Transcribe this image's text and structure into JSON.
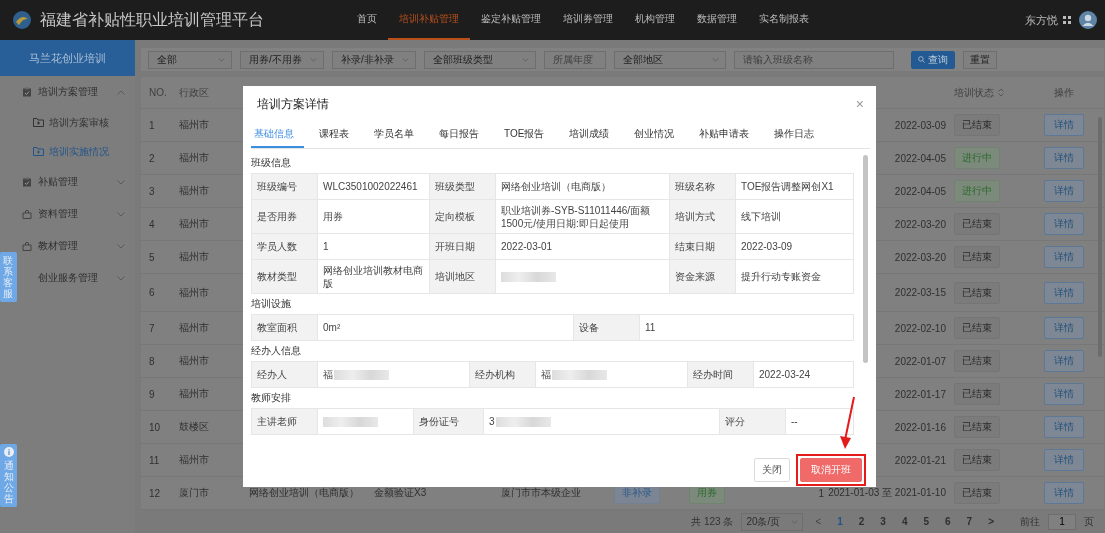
{
  "header": {
    "title": "福建省补贴性职业培训管理平台",
    "user": "东方悦",
    "nav": [
      {
        "label": "首页",
        "selected": false
      },
      {
        "label": "培训补贴管理",
        "selected": true
      },
      {
        "label": "鉴定补贴管理",
        "selected": false
      },
      {
        "label": "培训券管理",
        "selected": false
      },
      {
        "label": "机构管理",
        "selected": false
      },
      {
        "label": "数据管理",
        "selected": false
      },
      {
        "label": "实名制报表",
        "selected": false
      }
    ]
  },
  "sidebar": {
    "title": "马兰花创业培训",
    "menu": [
      {
        "label": "培训方案管理",
        "expanded": true,
        "children": [
          {
            "label": "培训方案审核",
            "selected": false
          },
          {
            "label": "培训实施情况",
            "selected": true
          }
        ]
      },
      {
        "label": "补贴管理",
        "expanded": false
      },
      {
        "label": "资料管理",
        "expanded": false
      },
      {
        "label": "教材管理",
        "expanded": false
      },
      {
        "label": "创业服务管理",
        "expanded": false
      }
    ]
  },
  "float_tabs": [
    "联系客服",
    "通知公告"
  ],
  "filters": [
    {
      "kind": "select",
      "value": "全部"
    },
    {
      "kind": "select",
      "value": "用券/不用券"
    },
    {
      "kind": "select",
      "value": "补录/非补录"
    },
    {
      "kind": "select",
      "value": "全部班级类型"
    },
    {
      "kind": "input",
      "placeholder": "所属年度"
    },
    {
      "kind": "select",
      "value": "全部地区"
    },
    {
      "kind": "input",
      "placeholder": "请输入班级名称"
    }
  ],
  "search_button": "查询",
  "reset_button": "重置",
  "table": {
    "columns": [
      "NO.",
      "行政区",
      "培训状态",
      "操作"
    ],
    "rows": [
      {
        "no": "1",
        "district": "福州市",
        "dates": "2022-03-09",
        "status": {
          "label": "已结束",
          "kind": "ended"
        },
        "action": "详情"
      },
      {
        "no": "2",
        "district": "福州市",
        "dates": "2022-04-05",
        "status": {
          "label": "进行中",
          "kind": "ongoing"
        },
        "action": "详情"
      },
      {
        "no": "3",
        "district": "福州市",
        "dates": "2022-04-05",
        "status": {
          "label": "进行中",
          "kind": "ongoing"
        },
        "action": "详情"
      },
      {
        "no": "4",
        "district": "福州市",
        "dates": "2022-03-20",
        "status": {
          "label": "已结束",
          "kind": "ended"
        },
        "action": "详情"
      },
      {
        "no": "5",
        "district": "福州市",
        "dates": "2022-03-20",
        "status": {
          "label": "已结束",
          "kind": "ended"
        },
        "action": "详情"
      },
      {
        "no": "6",
        "district": "福州市",
        "dates": "2022-03-15",
        "status": {
          "label": "已结束",
          "kind": "ended"
        },
        "action": "详情"
      },
      {
        "no": "7",
        "district": "福州市",
        "dates": "2022-02-10",
        "status": {
          "label": "已结束",
          "kind": "ended"
        },
        "action": "详情"
      },
      {
        "no": "8",
        "district": "福州市",
        "dates": "2022-01-07",
        "status": {
          "label": "已结束",
          "kind": "ended"
        },
        "action": "详情"
      },
      {
        "no": "9",
        "district": "福州市",
        "dates": "2022-01-17",
        "status": {
          "label": "已结束",
          "kind": "ended"
        },
        "action": "详情"
      },
      {
        "no": "10",
        "district": "鼓楼区",
        "dates": "2022-01-16",
        "status": {
          "label": "已结束",
          "kind": "ended"
        },
        "action": "详情"
      },
      {
        "no": "11",
        "district": "福州市",
        "dates": "2022-01-21",
        "status": {
          "label": "已结束",
          "kind": "ended"
        },
        "action": "详情"
      },
      {
        "no": "12",
        "district": "厦门市",
        "class_type": "网络创业培训（电商版）",
        "amount": "金额验证X3",
        "org": "厦门市市本级企业",
        "tags": [
          {
            "label": "非补录",
            "kind": "info"
          },
          {
            "label": "用券",
            "kind": "success"
          }
        ],
        "count": "1",
        "dates": "2021-01-03 至 2021-01-10",
        "status": {
          "label": "已结束",
          "kind": "ended"
        },
        "action": "详情"
      }
    ]
  },
  "pagination": {
    "total": "共 123 条",
    "page_size": "20条/页",
    "prev": "<",
    "next": ">",
    "pages": [
      {
        "label": "1",
        "selected": true
      },
      {
        "label": "2",
        "selected": false
      },
      {
        "label": "3",
        "selected": false
      },
      {
        "label": "4",
        "selected": false
      },
      {
        "label": "5",
        "selected": false
      },
      {
        "label": "6",
        "selected": false
      },
      {
        "label": "7",
        "selected": false
      }
    ],
    "goto": "前往",
    "goto_value": "1",
    "goto_unit": "页"
  },
  "modal": {
    "title": "培训方案详情",
    "close": "×",
    "tabs": [
      {
        "label": "基础信息",
        "selected": true
      },
      {
        "label": "课程表",
        "selected": false
      },
      {
        "label": "学员名单",
        "selected": false
      },
      {
        "label": "每日报告",
        "selected": false
      },
      {
        "label": "TOE报告",
        "selected": false
      },
      {
        "label": "培训成绩",
        "selected": false
      },
      {
        "label": "创业情况",
        "selected": false
      },
      {
        "label": "补贴申请表",
        "selected": false
      },
      {
        "label": "操作日志",
        "selected": false
      }
    ],
    "sections": [
      {
        "title": "班级信息",
        "rows": [
          [
            {
              "label": "班级编号",
              "value": "WLC3501002022461"
            },
            {
              "label": "班级类型",
              "value": "网络创业培训（电商版）"
            },
            {
              "label": "班级名称",
              "value": "TOE报告调整网创X1"
            }
          ],
          [
            {
              "label": "是否用券",
              "value": "用券"
            },
            {
              "label": "定向模板",
              "value": "职业培训券-SYB-S11011446/面额1500元/使用日期:即日起使用"
            },
            {
              "label": "培训方式",
              "value": "线下培训"
            }
          ],
          [
            {
              "label": "学员人数",
              "value": "1"
            },
            {
              "label": "开班日期",
              "value": "2022-03-01"
            },
            {
              "label": "结束日期",
              "value": "2022-03-09"
            }
          ],
          [
            {
              "label": "教材类型",
              "value": "网络创业培训教材电商版"
            },
            {
              "label": "培训地区",
              "redacted": true
            },
            {
              "label": "资金来源",
              "value": "提升行动专账资金"
            }
          ]
        ]
      },
      {
        "title": "培训设施",
        "rows": [
          [
            {
              "label": "教室面积",
              "value": "0m²"
            },
            {
              "label": "设备",
              "value": "11"
            }
          ]
        ]
      },
      {
        "title": "经办人信息",
        "rows": [
          [
            {
              "label": "经办人",
              "value": "福",
              "redacted": true
            },
            {
              "label": "经办机构",
              "value": "福",
              "redacted": true
            },
            {
              "label": "经办时间",
              "value": "2022-03-24"
            }
          ]
        ]
      },
      {
        "title": "教师安排",
        "rows": [
          [
            {
              "label": "主讲老师",
              "redacted": true
            },
            {
              "label": "身份证号",
              "value": "3",
              "redacted": true
            },
            {
              "label": "评分",
              "value": "--"
            }
          ]
        ]
      }
    ],
    "buttons": [
      {
        "label": "关闭",
        "kind": "default",
        "highlighted": false
      },
      {
        "label": "取消开班",
        "kind": "danger",
        "highlighted": true
      }
    ]
  }
}
